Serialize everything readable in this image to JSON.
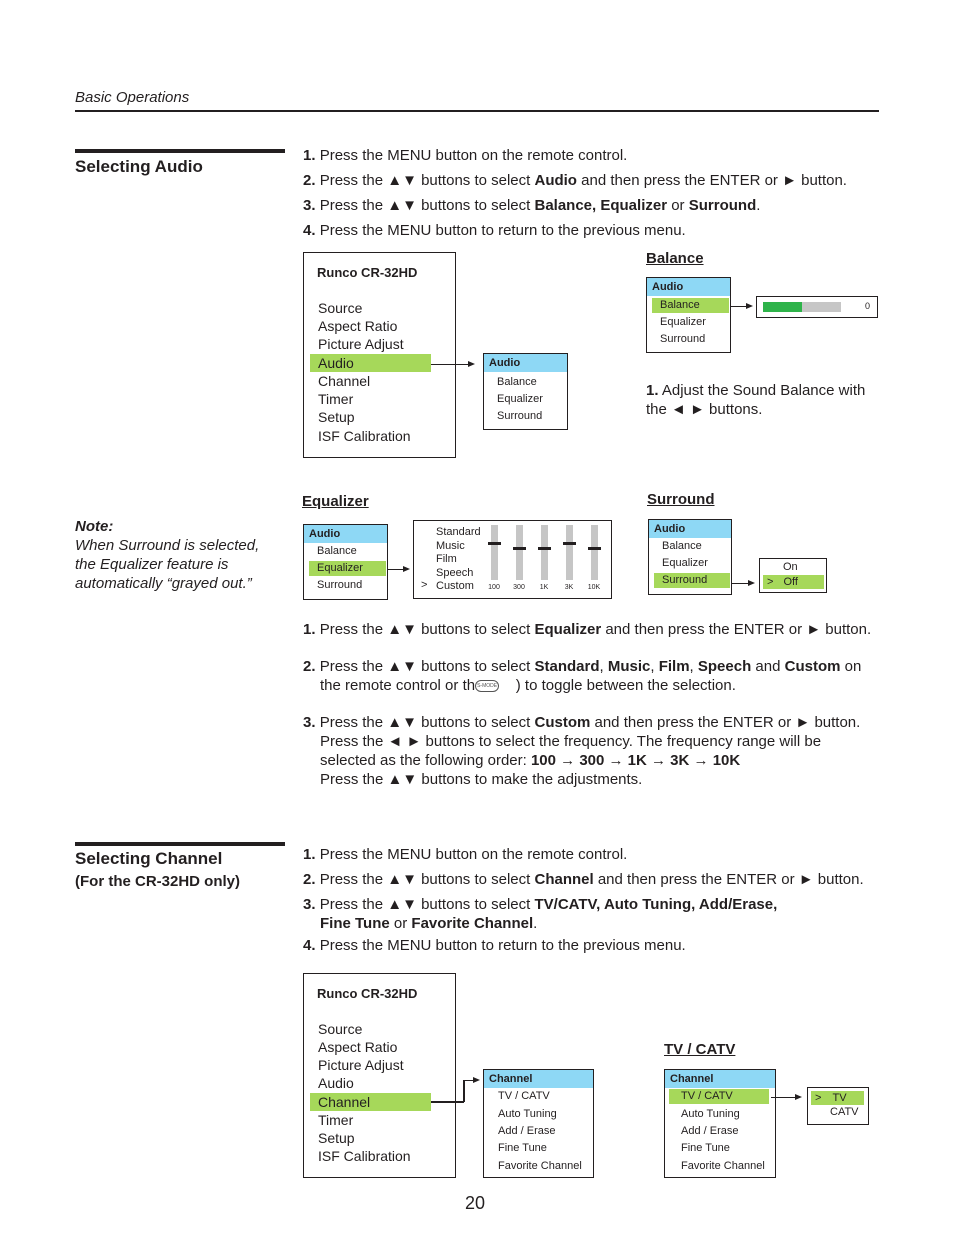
{
  "header": {
    "section": "Basic Operations"
  },
  "page_number": "20",
  "audio": {
    "title": "Selecting Audio",
    "steps": [
      {
        "num": "1.",
        "parts": [
          "Press the MENU button on the remote control."
        ]
      },
      {
        "num": "2.",
        "pre": "Press the ▲▼ buttons to select ",
        "bold": "Audio",
        "post": " and then press the ENTER or ► button."
      },
      {
        "num": "3.",
        "pre": "Press the ▲▼ buttons to select ",
        "bold": "Balance, Equalizer",
        "mid": " or ",
        "bold2": "Surround",
        "post": "."
      },
      {
        "num": "4.",
        "text": "Press the MENU button to return to the previous menu."
      }
    ],
    "main_menu": {
      "title": "Runco CR-32HD",
      "items": [
        "Source",
        "Aspect Ratio",
        "Picture Adjust",
        "Audio",
        "Channel",
        "Timer",
        "Setup",
        "ISF Calibration"
      ],
      "selected": "Audio"
    },
    "sub_menu": {
      "header": "Audio",
      "items": [
        "Balance",
        "Equalizer",
        "Surround"
      ]
    },
    "balance": {
      "title": "Balance",
      "selected": "Balance",
      "bar_fill_fraction": 0.5,
      "value": "0",
      "instruction_num": "1.",
      "instruction": "Adjust the Sound Balance with the ◄ ► buttons."
    },
    "equalizer": {
      "title": "Equalizer",
      "selected": "Equalizer",
      "presets": [
        "Standard",
        "Music",
        "Film",
        "Speech",
        "Custom"
      ],
      "current_preset": "Custom",
      "cursor": ">",
      "bands": [
        {
          "label": "100",
          "level": 0.3
        },
        {
          "label": "300",
          "level": 0.4
        },
        {
          "label": "1K",
          "level": 0.4
        },
        {
          "label": "3K",
          "level": 0.3
        },
        {
          "label": "10K",
          "level": 0.4
        }
      ]
    },
    "surround": {
      "title": "Surround",
      "selected": "Surround",
      "options": [
        "On",
        "Off"
      ],
      "current": "Off",
      "cursor": ">"
    },
    "note": {
      "label": "Note:",
      "text": "When Surround is selected, the Equalizer feature is automatically “grayed out.”"
    },
    "eq_steps": {
      "s1": {
        "num": "1.",
        "pre": "Press the ▲▼ buttons to select ",
        "b1": "Equalizer",
        "post": " and then press the ENTER or ► button."
      },
      "s2": {
        "num": "2.",
        "pre": "Press the ▲▼ buttons to select ",
        "b1": "Standard",
        "c1": ", ",
        "b2": "Music",
        "c2": ", ",
        "b3": "Film",
        "c3": ", ",
        "b4": "Speech",
        "c4": " and ",
        "b5": "Custom",
        "c5": " on",
        "line2_pre": "the remote control or th",
        "smode": "S-MODE",
        "line2_post": " ) to toggle between the selection."
      },
      "s3": {
        "num": "3.",
        "pre": "Press the ▲▼ buttons to select ",
        "b1": "Custom",
        "post": " and then press the ENTER or ► button.",
        "line2": "Press the ◄ ► buttons to select the frequency. The frequency range will be",
        "line3_pre": "selected as the following order: ",
        "line3_bold": "100 → 300 → 1K → 3K → 10K",
        "line4": "Press the ▲▼ buttons to make the adjustments."
      }
    }
  },
  "channel": {
    "title": "Selecting Channel",
    "subtitle": "(For the CR-32HD only)",
    "steps": {
      "s1": {
        "num": "1.",
        "text": "Press the MENU button on the remote control."
      },
      "s2": {
        "num": "2.",
        "pre": "Press the ▲▼ buttons to select ",
        "b1": "Channel",
        "post": " and then press the ENTER or ► button."
      },
      "s3": {
        "num": "3.",
        "pre": "Press the ▲▼ buttons to select ",
        "b1": "TV/CATV, Auto Tuning, Add/Erase,",
        "line2_b1": "Fine Tune",
        "line2_mid": " or ",
        "line2_b2": "Favorite Channel",
        "line2_post": "."
      },
      "s4": {
        "num": "4.",
        "text": "Press the MENU button to return to the previous menu."
      }
    },
    "main_menu": {
      "title": "Runco CR-32HD",
      "items": [
        "Source",
        "Aspect Ratio",
        "Picture Adjust",
        "Audio",
        "Channel",
        "Timer",
        "Setup",
        "ISF Calibration"
      ],
      "selected": "Channel"
    },
    "sub_menu": {
      "header": "Channel",
      "items": [
        "TV / CATV",
        "Auto Tuning",
        "Add / Erase",
        "Fine Tune",
        "Favorite Channel"
      ]
    },
    "tvcatv": {
      "title": "TV / CATV",
      "selected": "TV / CATV",
      "options": [
        "TV",
        "CATV"
      ],
      "current": "TV",
      "cursor": ">"
    }
  },
  "colors": {
    "highlight_green": "#a6d85a",
    "header_blue": "#8ed8f5",
    "balance_green": "#2eb34a",
    "track_gray": "#c6c6c6"
  }
}
